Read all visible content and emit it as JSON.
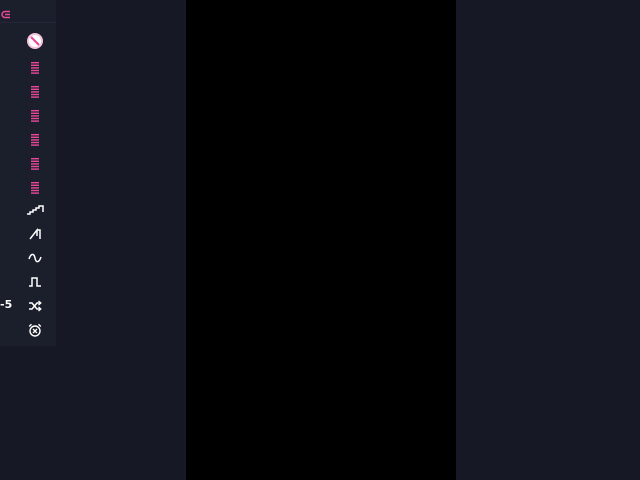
{
  "theme": {
    "background": "#161925",
    "panel": "#1b1e2b",
    "canvas": "#000000",
    "accent": "#e84a9a",
    "icon_light": "#ffffff"
  },
  "header": {
    "icon": "link-icon"
  },
  "toolbar": {
    "items": [
      {
        "icon": "prohibited-icon"
      },
      {
        "icon": "list-icon"
      },
      {
        "icon": "list-icon"
      },
      {
        "icon": "list-icon"
      },
      {
        "icon": "list-icon"
      },
      {
        "icon": "list-icon"
      },
      {
        "icon": "list-icon"
      },
      {
        "icon": "stair-step-wave-icon"
      },
      {
        "icon": "sawtooth-wave-icon"
      },
      {
        "icon": "sine-wave-icon"
      },
      {
        "icon": "square-wave-icon"
      },
      {
        "icon": "shuffle-icon"
      },
      {
        "icon": "alarm-off-icon"
      }
    ],
    "side_label": "-5"
  }
}
